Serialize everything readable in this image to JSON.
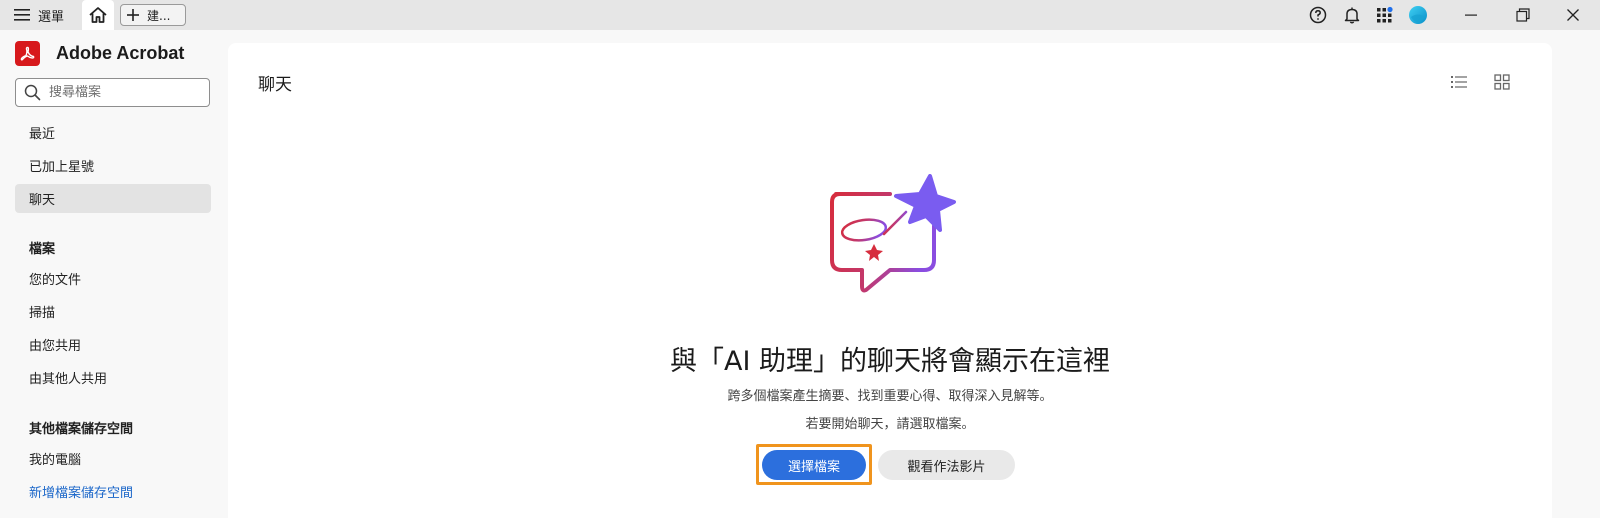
{
  "titlebar": {
    "menu_label": "選單",
    "new_tab_label": "建...",
    "icons": [
      "hamburger-icon",
      "home-icon",
      "plus-icon",
      "help-icon",
      "bell-icon",
      "apps-icon",
      "profile-icon",
      "minimize-icon",
      "restore-icon",
      "close-icon"
    ]
  },
  "sidebar": {
    "app_name": "Adobe Acrobat",
    "search_placeholder": "搜尋檔案",
    "primary_items": [
      {
        "label": "最近"
      },
      {
        "label": "已加上星號"
      },
      {
        "label": "聊天",
        "active": true
      }
    ],
    "files_heading": "檔案",
    "file_items": [
      {
        "label": "您的文件"
      },
      {
        "label": "掃描"
      },
      {
        "label": "由您共用"
      },
      {
        "label": "由其他人共用"
      }
    ],
    "storage_heading": "其他檔案儲存空間",
    "storage_items": [
      {
        "label": "我的電腦"
      },
      {
        "label": "新增檔案儲存空間"
      }
    ]
  },
  "main": {
    "title": "聊天",
    "view_icons": [
      "list-view-icon",
      "grid-view-icon"
    ],
    "empty_state": {
      "heading": "與「AI 助理」的聊天將會顯示在這裡",
      "description": "跨多個檔案產生摘要、找到重要心得、取得深入見解等。",
      "hint": "若要開始聊天，請選取檔案。",
      "primary_button": "選擇檔案",
      "secondary_button": "觀看作法影片"
    }
  },
  "colors": {
    "accent": "#2c6fdd",
    "focus_ring": "#f0941d",
    "brand_red": "#d7191c",
    "link": "#1a66c9"
  }
}
